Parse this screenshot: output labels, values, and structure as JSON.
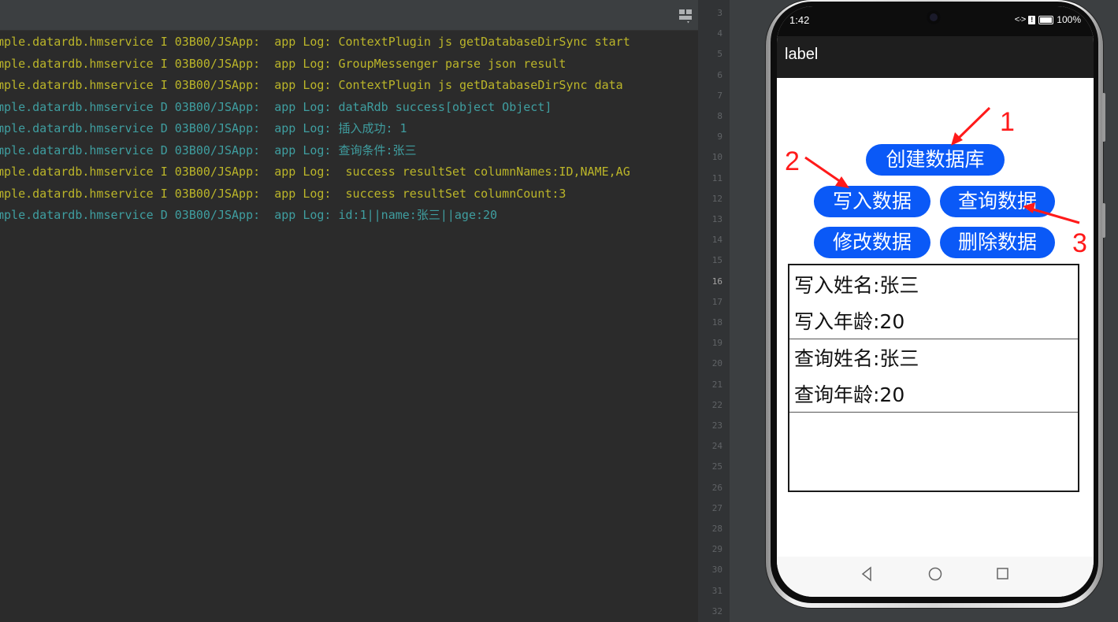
{
  "log": {
    "lines": [
      {
        "level": "I",
        "text": "mple.datardb.hmservice I 03B00/JSApp:  app Log: ContextPlugin js getDatabaseDirSync start"
      },
      {
        "level": "I",
        "text": "mple.datardb.hmservice I 03B00/JSApp:  app Log: GroupMessenger parse json result"
      },
      {
        "level": "I",
        "text": "mple.datardb.hmservice I 03B00/JSApp:  app Log: ContextPlugin js getDatabaseDirSync data"
      },
      {
        "level": "D",
        "text": "mple.datardb.hmservice D 03B00/JSApp:  app Log: dataRdb success[object Object]"
      },
      {
        "level": "D",
        "text": "mple.datardb.hmservice D 03B00/JSApp:  app Log: 插入成功: 1"
      },
      {
        "level": "D",
        "text": "mple.datardb.hmservice D 03B00/JSApp:  app Log: 查询条件:张三"
      },
      {
        "level": "I",
        "text": "mple.datardb.hmservice I 03B00/JSApp:  app Log:  success resultSet columnNames:ID,NAME,AG"
      },
      {
        "level": "I",
        "text": "mple.datardb.hmservice I 03B00/JSApp:  app Log:  success resultSet columnCount:3"
      },
      {
        "level": "D",
        "text": "mple.datardb.hmservice D 03B00/JSApp:  app Log: id:1||name:张三||age:20"
      }
    ]
  },
  "gutter": {
    "lines": [
      "3",
      "4",
      "5",
      "6",
      "7",
      "8",
      "9",
      "10",
      "11",
      "12",
      "13",
      "14",
      "15",
      "16",
      "17",
      "18",
      "19",
      "20",
      "21",
      "22",
      "23",
      "24",
      "25",
      "26",
      "27",
      "28",
      "29",
      "30",
      "31",
      "32"
    ],
    "active": "16"
  },
  "phone": {
    "status": {
      "time": "1:42",
      "network": "<·>",
      "battery": "100%"
    },
    "app_bar": {
      "title": "label"
    },
    "buttons": {
      "create_db": "创建数据库",
      "insert": "写入数据",
      "query": "查询数据",
      "update": "修改数据",
      "delete": "删除数据"
    },
    "results": {
      "write_name": "写入姓名:张三",
      "write_age": "写入年龄:20",
      "query_name": "查询姓名:张三",
      "query_age": "查询年龄:20"
    }
  },
  "annotations": {
    "n1": "1",
    "n2": "2",
    "n3": "3",
    "color": "#ff1a1a"
  }
}
